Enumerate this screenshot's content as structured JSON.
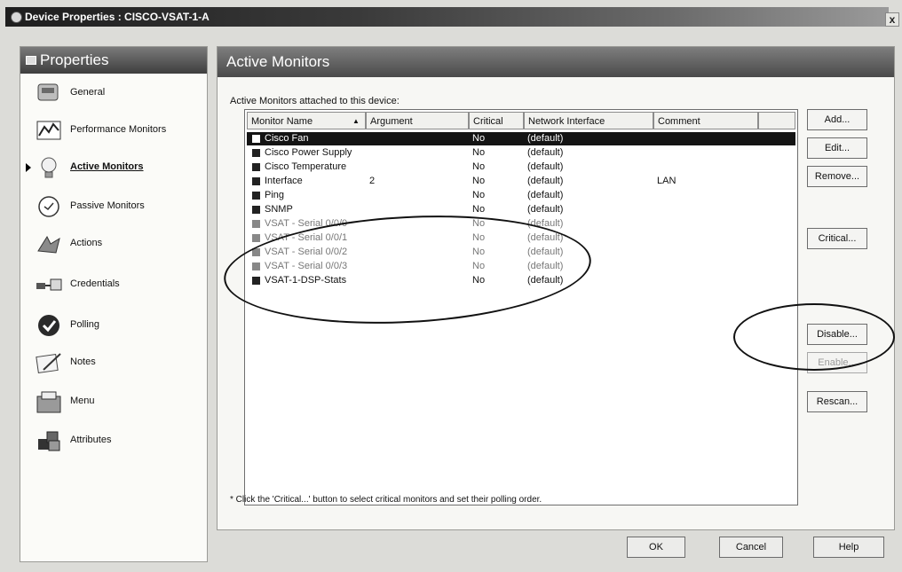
{
  "window": {
    "title": "Device Properties : CISCO-VSAT-1-A",
    "close_label": "x"
  },
  "sidebar": {
    "header": "Properties",
    "items": [
      {
        "label": "General",
        "icon": "general-icon"
      },
      {
        "label": "Performance Monitors",
        "icon": "performance-icon"
      },
      {
        "label": "Active Monitors",
        "icon": "lightbulb-icon",
        "active": true
      },
      {
        "label": "Passive Monitors",
        "icon": "passive-icon"
      },
      {
        "label": "Actions",
        "icon": "actions-icon"
      },
      {
        "label": "Credentials",
        "icon": "credentials-icon"
      },
      {
        "label": "Polling",
        "icon": "polling-icon"
      },
      {
        "label": "Notes",
        "icon": "notes-icon"
      },
      {
        "label": "Menu",
        "icon": "menu-icon"
      },
      {
        "label": "Attributes",
        "icon": "attributes-icon"
      }
    ]
  },
  "panel": {
    "header": "Active Monitors",
    "attached_label": "Active Monitors attached to this device:",
    "footnote": "* Click the 'Critical...' button to select critical monitors and set their polling order."
  },
  "table": {
    "columns": [
      "Monitor Name",
      "Argument",
      "Critical",
      "Network Interface",
      "Comment"
    ],
    "sort_indicator": "▲",
    "rows": [
      {
        "name": "Cisco Fan",
        "argument": "",
        "critical": "No",
        "interface": "(default)",
        "comment": "",
        "selected": true
      },
      {
        "name": "Cisco Power Supply",
        "argument": "",
        "critical": "No",
        "interface": "(default)",
        "comment": ""
      },
      {
        "name": "Cisco Temperature",
        "argument": "",
        "critical": "No",
        "interface": "(default)",
        "comment": ""
      },
      {
        "name": "Interface",
        "argument": "2",
        "critical": "No",
        "interface": "(default)",
        "comment": "LAN"
      },
      {
        "name": "Ping",
        "argument": "",
        "critical": "No",
        "interface": "(default)",
        "comment": ""
      },
      {
        "name": "SNMP",
        "argument": "",
        "critical": "No",
        "interface": "(default)",
        "comment": ""
      },
      {
        "name": "VSAT - Serial 0/0/0",
        "argument": "",
        "critical": "No",
        "interface": "(default)",
        "comment": "",
        "dim": true
      },
      {
        "name": "VSAT - Serial 0/0/1",
        "argument": "",
        "critical": "No",
        "interface": "(default)",
        "comment": "",
        "dim": true
      },
      {
        "name": "VSAT - Serial 0/0/2",
        "argument": "",
        "critical": "No",
        "interface": "(default)",
        "comment": "",
        "dim": true
      },
      {
        "name": "VSAT - Serial 0/0/3",
        "argument": "",
        "critical": "No",
        "interface": "(default)",
        "comment": "",
        "dim": true
      },
      {
        "name": "VSAT-1-DSP-Stats",
        "argument": "",
        "critical": "No",
        "interface": "(default)",
        "comment": ""
      }
    ]
  },
  "buttons": {
    "add": "Add...",
    "edit": "Edit...",
    "remove": "Remove...",
    "critical": "Critical...",
    "disable": "Disable...",
    "enable": "Enable...",
    "rescan": "Rescan...",
    "ok": "OK",
    "cancel": "Cancel",
    "help": "Help"
  }
}
